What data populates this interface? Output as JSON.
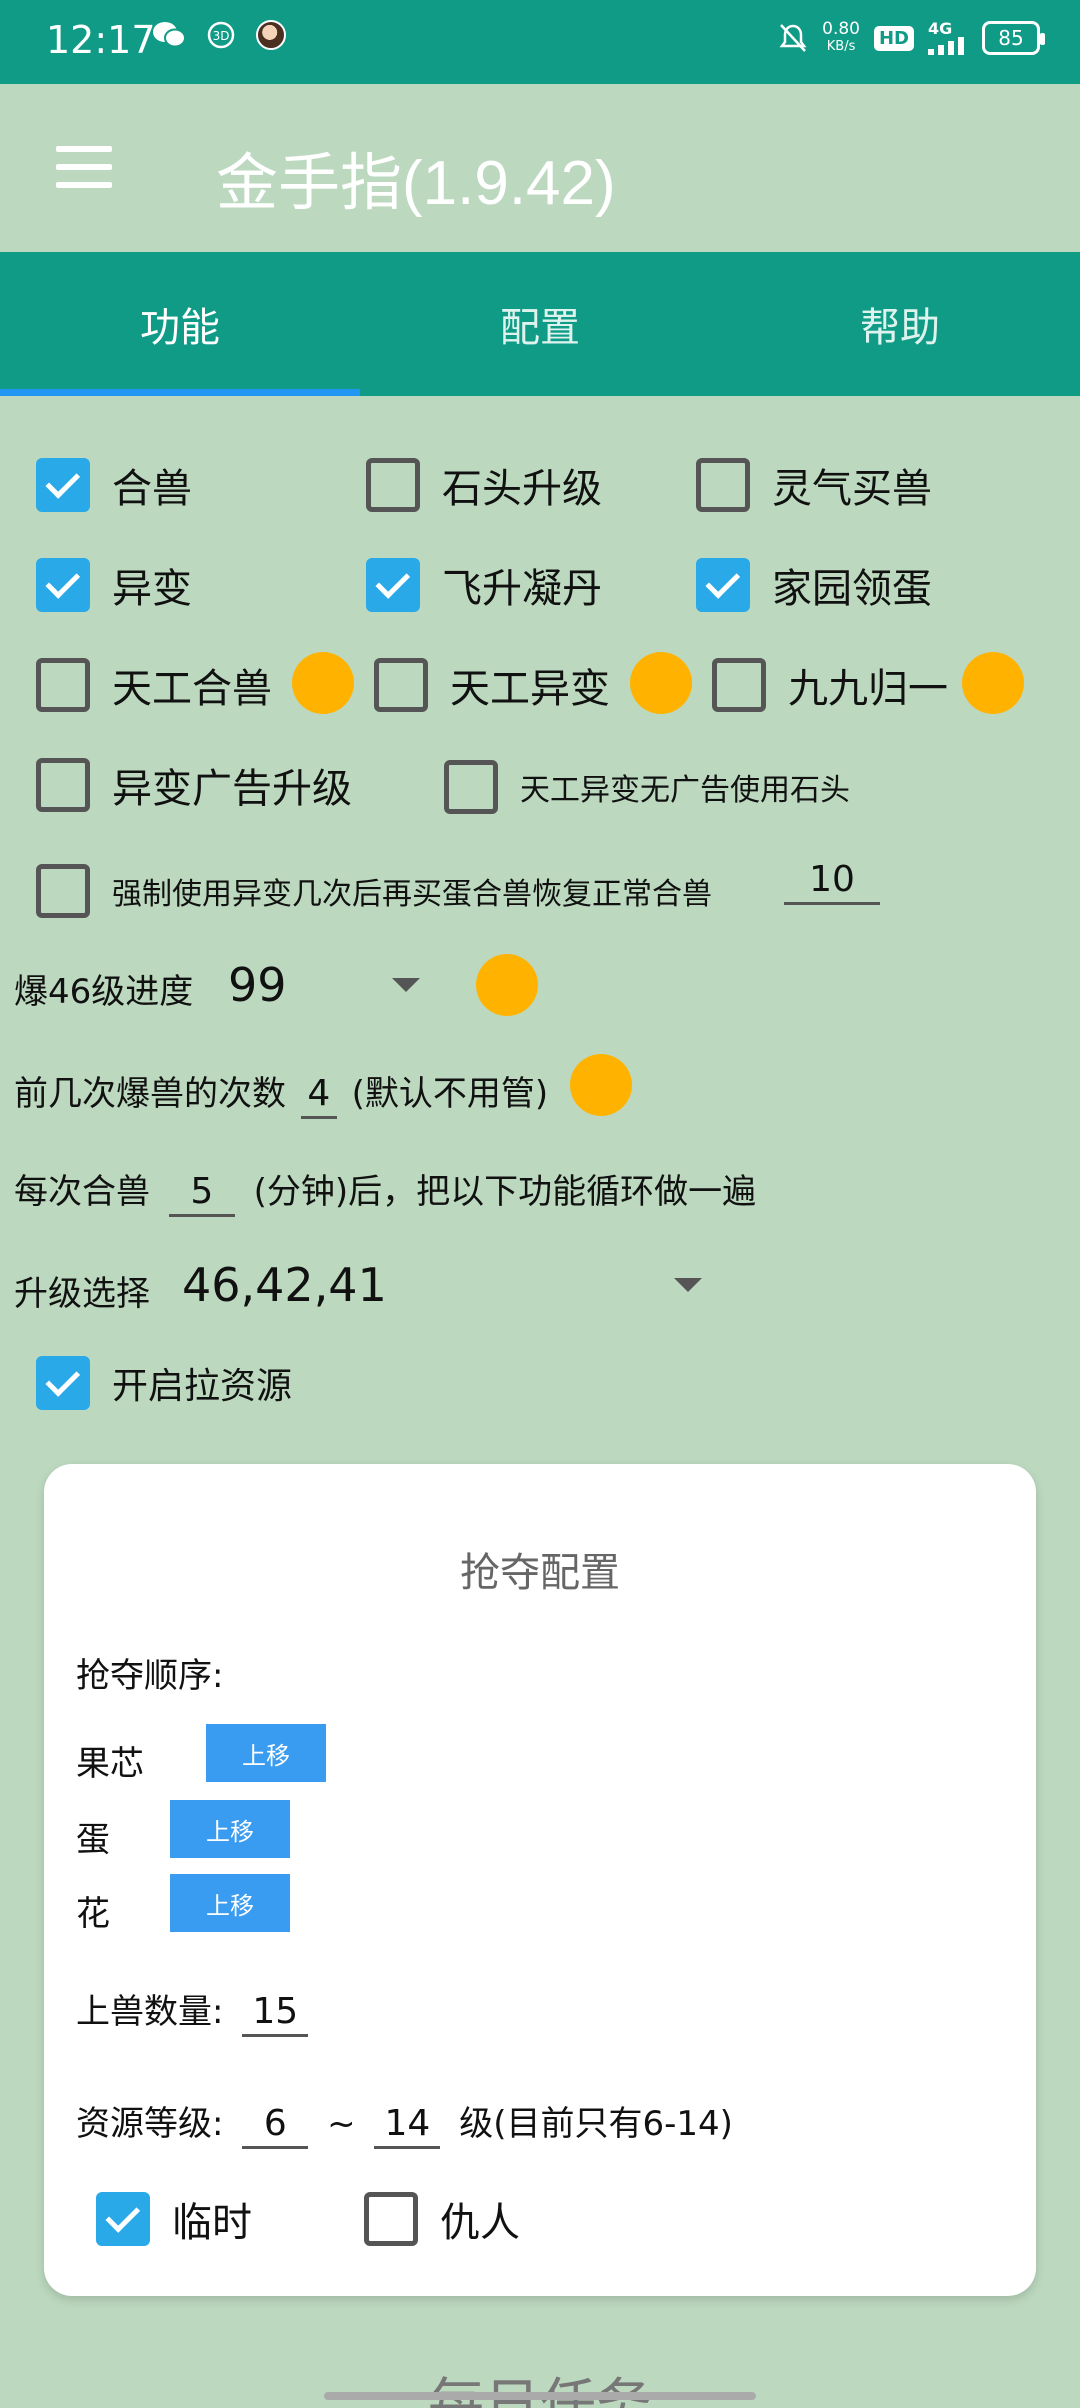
{
  "status_bar": {
    "time": "12:17",
    "net_speed": "0.80",
    "net_unit": "KB/s",
    "hd_label": "HD",
    "net_type": "4G",
    "battery": "85",
    "icons": [
      "wechat-icon",
      "3d-icon",
      "avatar",
      "mute-icon",
      "signal-icon",
      "battery-icon"
    ]
  },
  "app": {
    "title": "金手指(1.9.42)"
  },
  "tabs": [
    {
      "label": "功能",
      "active": true
    },
    {
      "label": "配置",
      "active": false
    },
    {
      "label": "帮助",
      "active": false
    }
  ],
  "features": {
    "row1": [
      {
        "label": "合兽",
        "checked": true
      },
      {
        "label": "石头升级",
        "checked": false
      },
      {
        "label": "灵气买兽",
        "checked": false
      }
    ],
    "row2": [
      {
        "label": "异变",
        "checked": true
      },
      {
        "label": "飞升凝丹",
        "checked": true
      },
      {
        "label": "家园领蛋",
        "checked": true
      }
    ],
    "row3": [
      {
        "label": "天工合兽",
        "checked": false
      },
      {
        "label": "天工异变",
        "checked": false
      },
      {
        "label": "九九归一",
        "checked": false
      }
    ],
    "row4": [
      {
        "label": "异变广告升级",
        "checked": false
      },
      {
        "label": "天工异变无广告使用石头",
        "checked": false
      }
    ],
    "force": {
      "label": "强制使用异变几次后再买蛋合兽恢复正常合兽",
      "checked": false,
      "value": "10"
    }
  },
  "settings": {
    "explode_label": "爆46级进度",
    "explode_value": "99",
    "first_times_label": "前几次爆兽的次数",
    "first_times_value": "4",
    "first_times_note": "(默认不用管)",
    "interval_prefix": "每次合兽",
    "interval_value": "5",
    "interval_suffix": "(分钟)后，把以下功能循环做一遍",
    "upgrade_label": "升级选择",
    "upgrade_value": "46,42,41",
    "pull_resource": {
      "label": "开启拉资源",
      "checked": true
    }
  },
  "rob_config": {
    "title": "抢夺配置",
    "order_label": "抢夺顺序:",
    "items": [
      {
        "label": "果芯",
        "button": "上移"
      },
      {
        "label": "蛋",
        "button": "上移"
      },
      {
        "label": "花",
        "button": "上移"
      }
    ],
    "count_label": "上兽数量:",
    "count_value": "15",
    "level_label": "资源等级:",
    "level_min": "6",
    "level_sep": "~",
    "level_max": "14",
    "level_note": "级(目前只有6-14)",
    "options": [
      {
        "label": "临时",
        "checked": true
      },
      {
        "label": "仇人",
        "checked": false
      }
    ]
  },
  "next_section": {
    "title": "每日任务"
  },
  "colors": {
    "teal": "#0f9b86",
    "background": "#bcd9bf",
    "checkbox_blue": "#2aa9e8",
    "info_dot": "#ffb300",
    "button_blue": "#3a9cf0"
  }
}
